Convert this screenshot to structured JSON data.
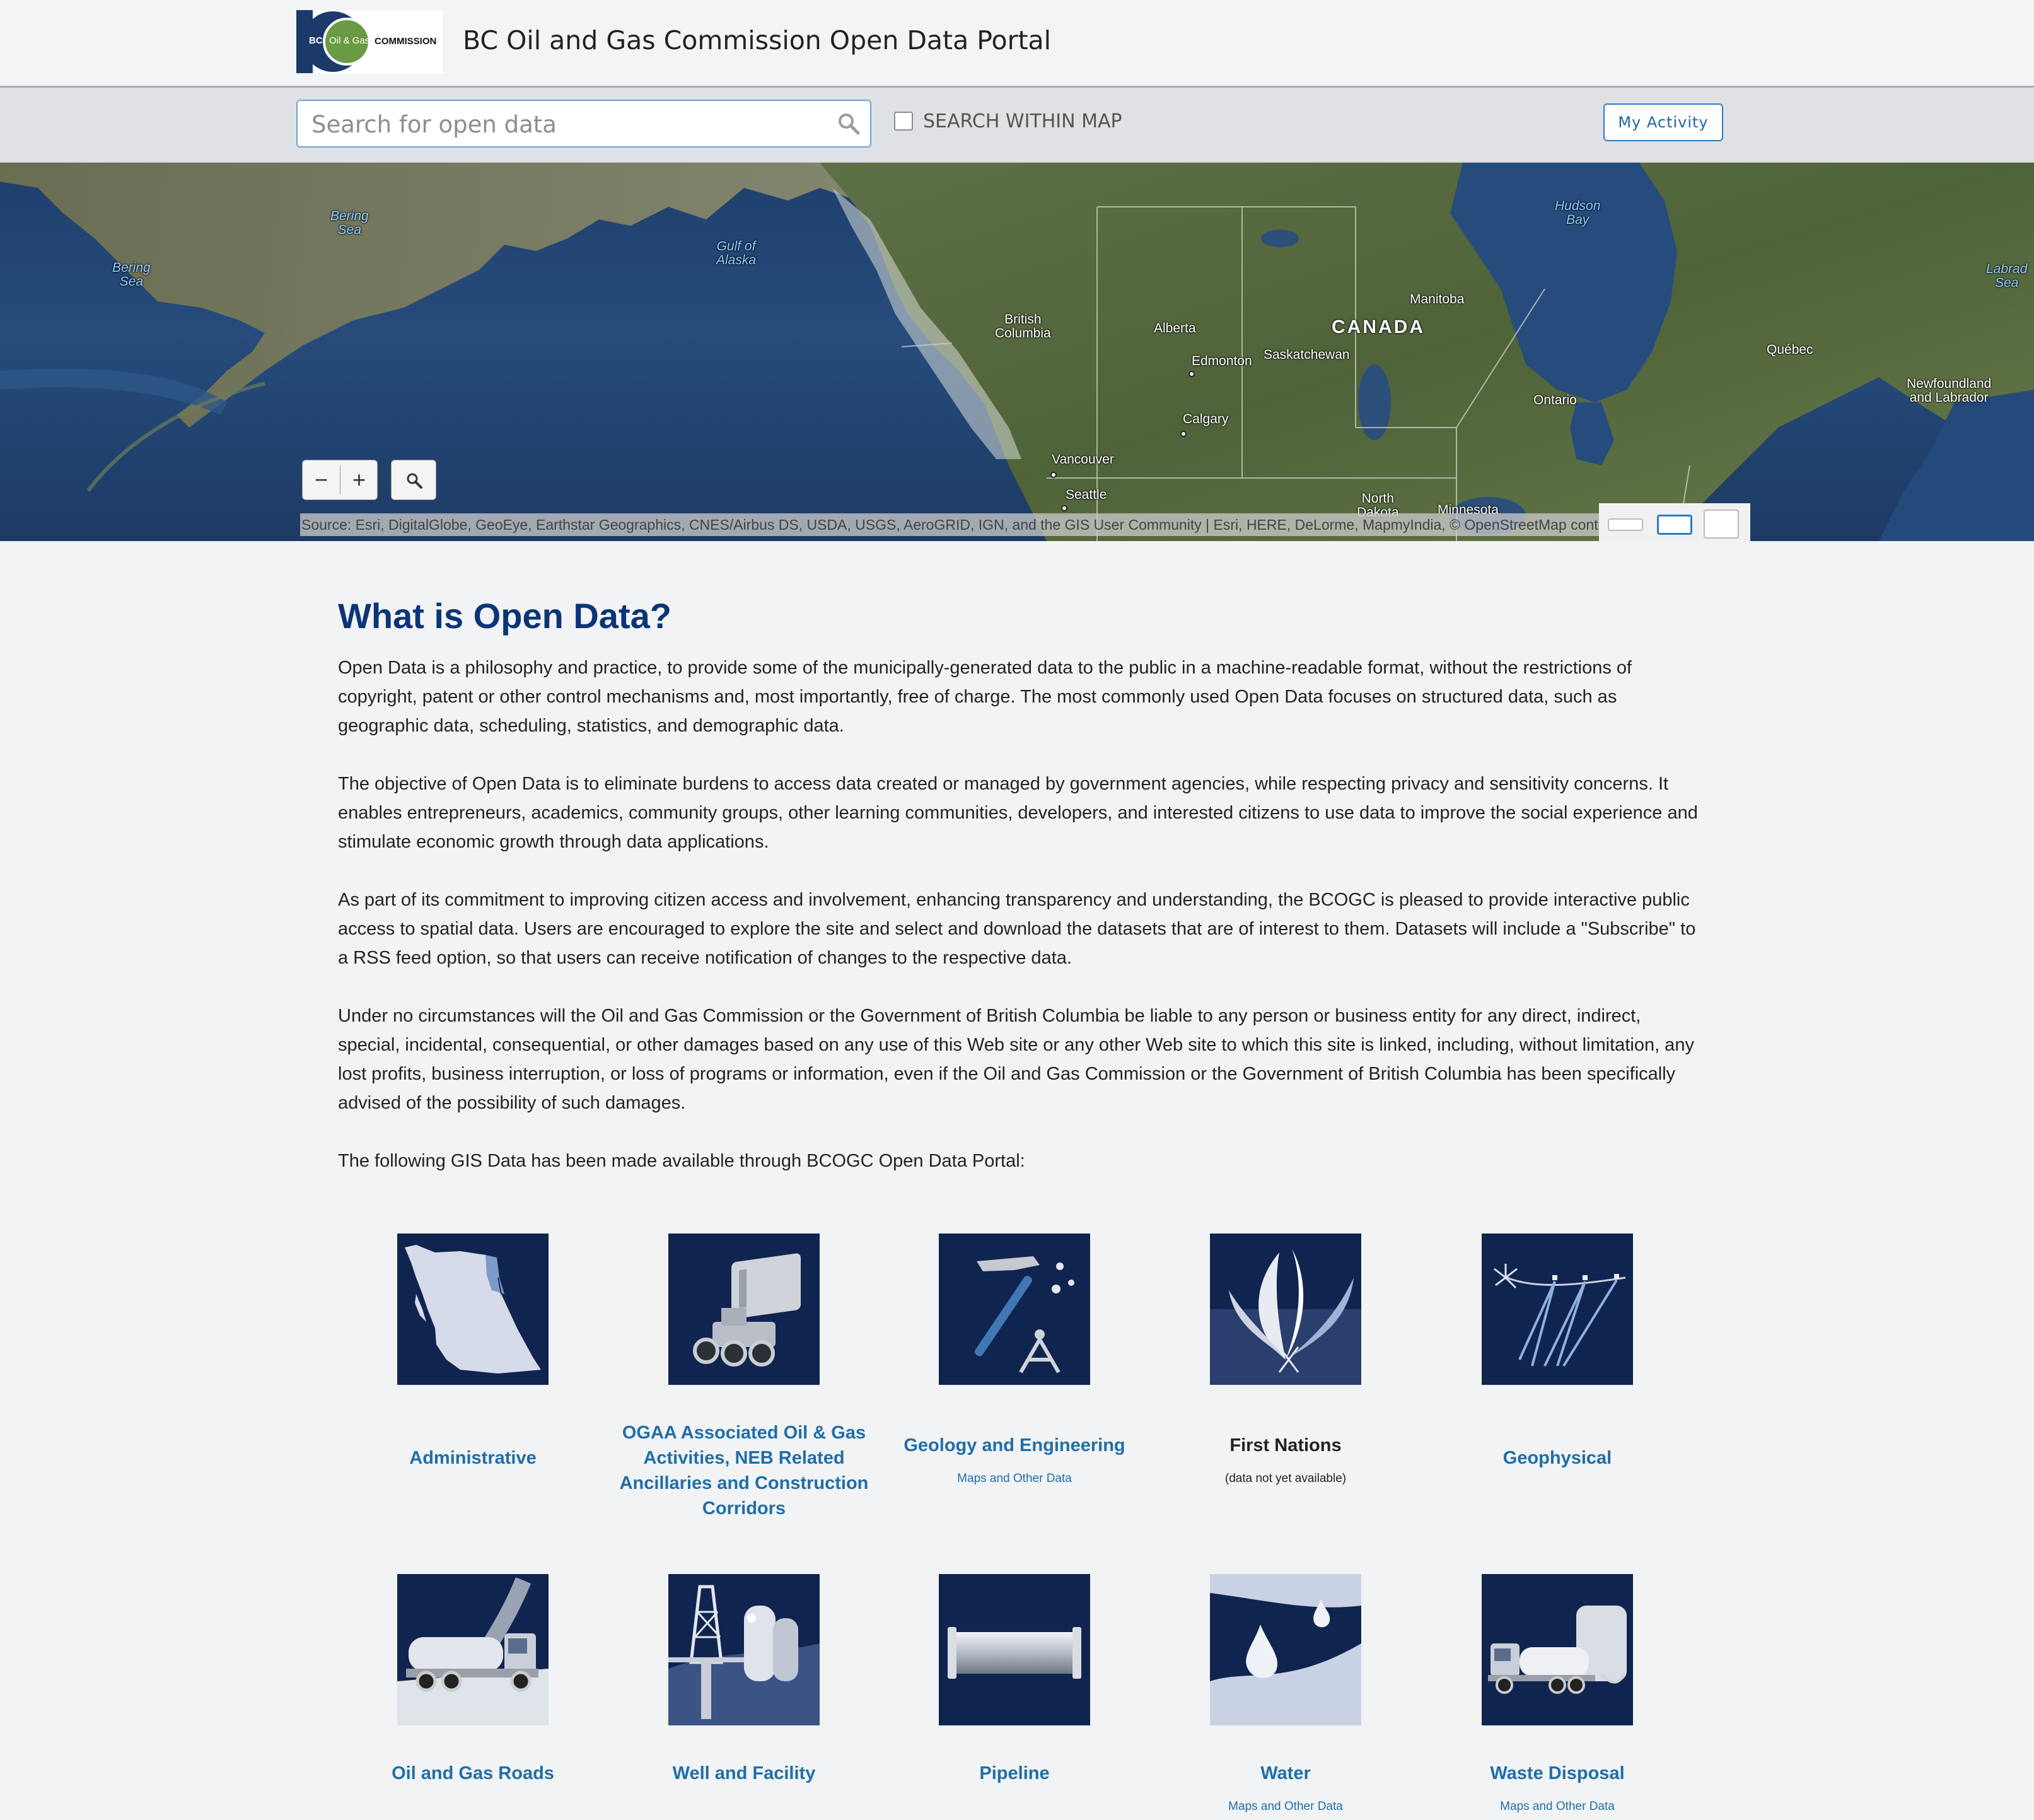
{
  "header": {
    "logo": {
      "bc": "BC",
      "oil_gas": "Oil & Gas",
      "commission": "COMMISSION"
    },
    "title": "BC Oil and Gas Commission Open Data Portal"
  },
  "search": {
    "placeholder": "Search for open data",
    "within_map_label": "SEARCH WITHIN MAP",
    "my_activity_label": "My Activity"
  },
  "map": {
    "labels": {
      "bering_sea_1": "Bering\nSea",
      "bering_sea_2": "Bering\nSea",
      "gulf_of_alaska": "Gulf of\nAlaska",
      "hudson_bay": "Hudson\nBay",
      "labrador_sea": "Labrad\nSea",
      "british_columbia": "British\nColumbia",
      "alberta": "Alberta",
      "canada": "CANADA",
      "manitoba": "Manitoba",
      "edmonton": "Edmonton",
      "saskatchewan": "Saskatchewan",
      "quebec": "Québec",
      "ontario": "Ontario",
      "newfoundland": "Newfoundland\nand Labrador",
      "calgary": "Calgary",
      "vancouver": "Vancouver",
      "seattle": "Seattle",
      "north_dakota": "North\nDakota",
      "minnesota": "Minnesota"
    },
    "zoom_out": "−",
    "zoom_in": "+",
    "attribution": "Source: Esri, DigitalGlobe, GeoEye, Earthstar Geographics, CNES/Airbus DS, USDA, USGS, AeroGRID, IGN, and the GIS User Community | Esri, HERE, DeLorme, MapmyIndia, © OpenStreetMap contributors"
  },
  "content": {
    "heading": "What is Open Data?",
    "paragraphs": [
      "Open Data is a philosophy and practice, to provide some of the municipally-generated data to the public in a machine-readable format, without the restrictions of copyright, patent or other control mechanisms and, most importantly, free of charge. The most commonly used Open Data focuses on structured data, such as geographic data, scheduling, statistics, and demographic data.",
      "The objective of Open Data is to eliminate burdens to access data created or managed by government agencies, while respecting privacy and sensitivity concerns. It enables entrepreneurs, academics, community groups, other learning communities, developers, and interested citizens to use data to improve the social experience and stimulate economic growth through data applications.",
      "As part of its commitment to improving citizen access and involvement, enhancing transparency and understanding, the BCOGC is pleased to provide interactive public access to spatial data. Users are encouraged to explore the site and select and download the datasets that are of interest to them. Datasets will include a \"Subscribe\" to a RSS feed option, so that users can receive notification of changes to the respective data.",
      "Under no circumstances will the Oil and Gas Commission or the Government of British Columbia be liable to any person or business entity for any direct, indirect, special, incidental, consequential, or other damages based on any use of this Web site or any other Web site to which this site is linked, including, without limitation, any lost profits, business interruption, or loss of programs or information, even if the Oil and Gas Commission or the Government of British Columbia has been specifically advised of the possibility of such damages.",
      "The following GIS Data has been made available through BCOGC Open Data Portal:"
    ]
  },
  "categories": [
    {
      "label": "Administrative",
      "sub": "",
      "icon": "bc-map-icon"
    },
    {
      "label": "OGAA Associated Oil & Gas Activities, NEB Related Ancillaries and Construction Corridors",
      "sub": "",
      "icon": "loader-icon"
    },
    {
      "label": "Geology and Engineering",
      "sub": "Maps and Other Data",
      "icon": "hammer-compass-icon"
    },
    {
      "label": "First Nations",
      "sub": "(data not yet available)",
      "icon": "feathers-icon"
    },
    {
      "label": "Geophysical",
      "sub": "",
      "icon": "seismic-icon"
    },
    {
      "label": "Oil and Gas Roads",
      "sub": "",
      "icon": "tanker-truck-icon"
    },
    {
      "label": "Well and Facility",
      "sub": "",
      "icon": "derrick-icon"
    },
    {
      "label": "Pipeline",
      "sub": "",
      "icon": "pipe-icon"
    },
    {
      "label": "Water",
      "sub": "Maps and Other Data",
      "icon": "water-drop-icon"
    },
    {
      "label": "Waste Disposal",
      "sub": "Maps and Other Data",
      "icon": "waste-truck-icon"
    }
  ]
}
